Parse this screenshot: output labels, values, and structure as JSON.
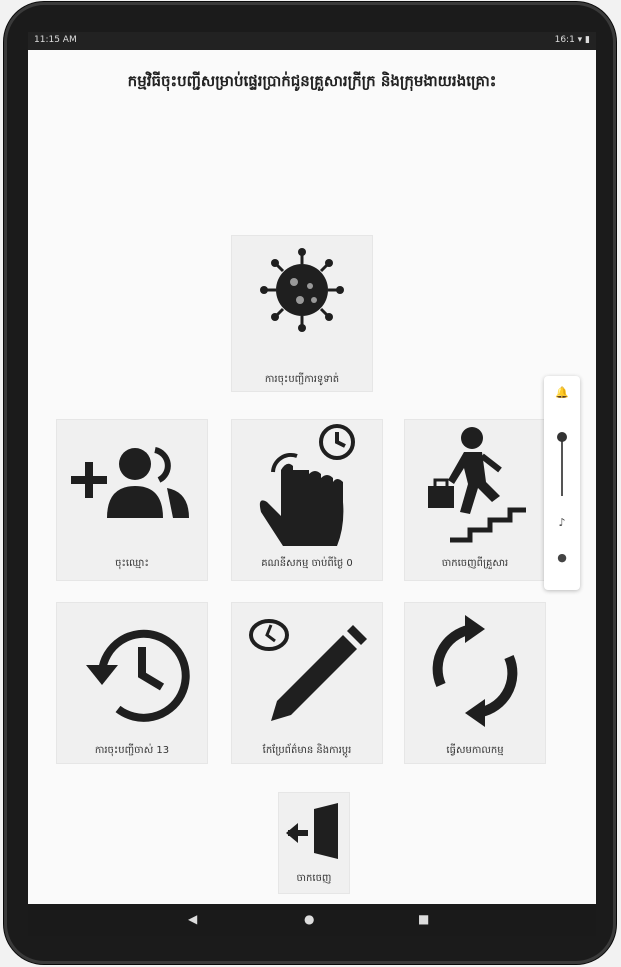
{
  "status_bar": {
    "time": "11:15 AM",
    "right": "16:1 ▾ ▮"
  },
  "header": {
    "title": "កម្មវិធីចុះបញ្ជីសម្រាប់ផ្ទេរប្រាក់ជូនគ្រួសារក្រីក្រ និងក្រុមងាយរងគ្រោះ"
  },
  "tiles": {
    "virus_label": "ការចុះបញ្ជីការទូទាត់",
    "add_people_label": "ចុះឈ្មោះ",
    "touch_time_label": "គណនីសកម្ម ចាប់ពីថ្ងៃ 0",
    "walk_stairs_label": "ចាកចេញពីគ្រួសារ",
    "history_label": "ការចុះបញ្ជីចាស់ 13",
    "edit_time_label": "កែប្រែព័ត៌មាន និងការប្ដូរ",
    "sync_label": "ធ្វើសមកាលកម្ម",
    "exit_label": "ចាកចេញ"
  },
  "icons": {
    "virus": "virus-icon",
    "add_people": "add-people-icon",
    "touch_time": "touch-clock-icon",
    "walk_stairs": "person-stairs-icon",
    "history": "history-icon",
    "edit_time": "pencil-clock-icon",
    "sync": "sync-icon",
    "exit": "exit-door-icon"
  },
  "nav": {
    "back": "◀",
    "home": "●",
    "recent": "■"
  },
  "colors": {
    "icon": "#1f1f1f",
    "tile": "#f0f0f0",
    "screen": "#fafafa"
  }
}
